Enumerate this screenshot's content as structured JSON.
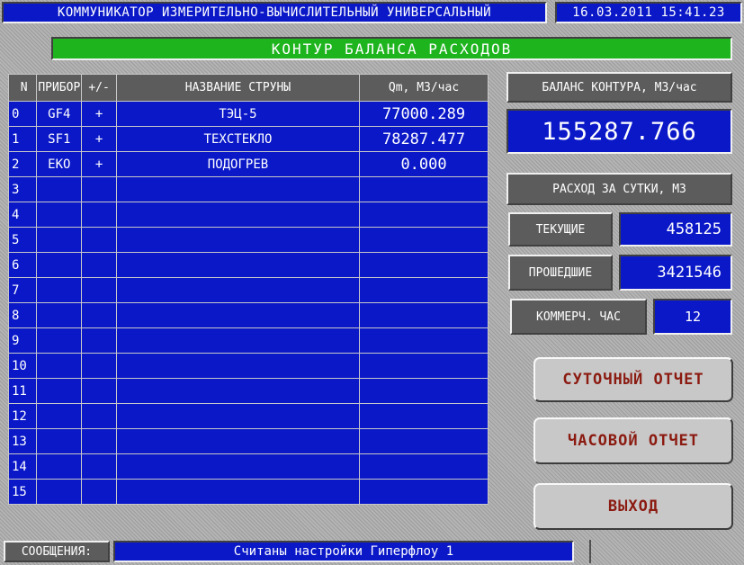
{
  "header": {
    "title": "КОММУНИКАТОР ИЗМЕРИТЕЛЬНО-ВЫЧИСЛИТЕЛЬНЫЙ УНИВЕРСАЛЬНЫЙ",
    "datetime": "16.03.2011 15:41.23"
  },
  "panel_title": "КОНТУР БАЛАНСА РАСХОДОВ",
  "table": {
    "columns": [
      "N",
      "ПРИБОР",
      "+/-",
      "НАЗВАНИЕ СТРУНЫ",
      "Qm, М3/час"
    ],
    "rows": [
      {
        "n": "0",
        "device": "GF4",
        "sign": "+",
        "name": "ТЭЦ-5",
        "value": "77000.289"
      },
      {
        "n": "1",
        "device": "SF1",
        "sign": "+",
        "name": "ТЕХСТЕКЛО",
        "value": "78287.477"
      },
      {
        "n": "2",
        "device": "EKO",
        "sign": "+",
        "name": "ПОДОГРЕВ",
        "value": "0.000"
      },
      {
        "n": "3",
        "device": "",
        "sign": "",
        "name": "",
        "value": ""
      },
      {
        "n": "4",
        "device": "",
        "sign": "",
        "name": "",
        "value": ""
      },
      {
        "n": "5",
        "device": "",
        "sign": "",
        "name": "",
        "value": ""
      },
      {
        "n": "6",
        "device": "",
        "sign": "",
        "name": "",
        "value": ""
      },
      {
        "n": "7",
        "device": "",
        "sign": "",
        "name": "",
        "value": ""
      },
      {
        "n": "8",
        "device": "",
        "sign": "",
        "name": "",
        "value": ""
      },
      {
        "n": "9",
        "device": "",
        "sign": "",
        "name": "",
        "value": ""
      },
      {
        "n": "10",
        "device": "",
        "sign": "",
        "name": "",
        "value": ""
      },
      {
        "n": "11",
        "device": "",
        "sign": "",
        "name": "",
        "value": ""
      },
      {
        "n": "12",
        "device": "",
        "sign": "",
        "name": "",
        "value": ""
      },
      {
        "n": "13",
        "device": "",
        "sign": "",
        "name": "",
        "value": ""
      },
      {
        "n": "14",
        "device": "",
        "sign": "",
        "name": "",
        "value": ""
      },
      {
        "n": "15",
        "device": "",
        "sign": "",
        "name": "",
        "value": ""
      }
    ]
  },
  "balance": {
    "label": "БАЛАНС КОНТУРА, М3/час",
    "value": "155287.766"
  },
  "daily": {
    "label": "РАСХОД ЗА СУТКИ, М3",
    "current_label": "ТЕКУЩИЕ",
    "current_value": "458125",
    "past_label": "ПРОШЕДШИЕ",
    "past_value": "3421546",
    "commercial_label": "КОММЕРЧ. ЧАС",
    "commercial_value": "12"
  },
  "buttons": {
    "daily_report": "СУТОЧНЫЙ ОТЧЕТ",
    "hourly_report": "ЧАСОВОЙ ОТЧЕТ",
    "exit": "ВЫХОД"
  },
  "status": {
    "label": "СООБЩЕНИЯ:",
    "message": "Считаны настройки Гиперфлоу 1"
  },
  "colors": {
    "panel_blue": "#0a18c8",
    "title_green": "#1eb41e",
    "button_text": "#8b1a10",
    "label_gray": "#5c5c5c"
  }
}
